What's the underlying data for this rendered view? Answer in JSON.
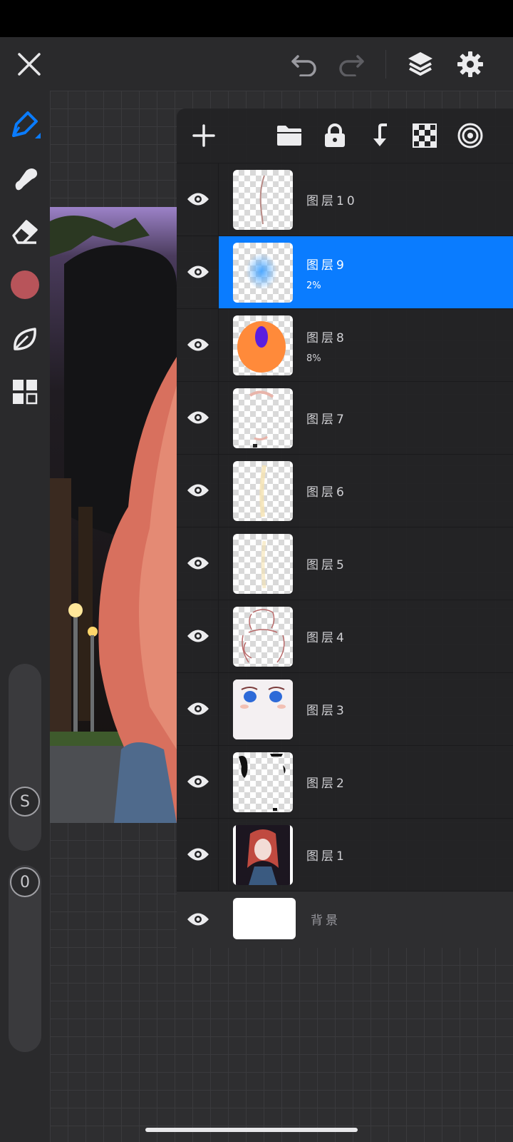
{
  "colors": {
    "accent": "#0a7cff",
    "brush_color": "#b8545a"
  },
  "icons": {
    "top": [
      "close-icon",
      "undo-icon",
      "redo-icon",
      "layers-icon",
      "gear-icon"
    ],
    "tools": [
      "pen-icon",
      "smudge-icon",
      "eraser-icon",
      "color-swatch",
      "leaf-icon",
      "grid-icon"
    ],
    "panel": [
      "add-icon",
      "folder-icon",
      "lock-icon",
      "merge-down-icon",
      "checker-icon",
      "target-icon"
    ]
  },
  "sliders": {
    "size_label": "S",
    "opacity_label": "0"
  },
  "layers": [
    {
      "name": "图层10",
      "opacity": "",
      "selected": false
    },
    {
      "name": "图层9",
      "opacity": "2%",
      "selected": true
    },
    {
      "name": "图层8",
      "opacity": "8%",
      "selected": false
    },
    {
      "name": "图层7",
      "opacity": "",
      "selected": false
    },
    {
      "name": "图层6",
      "opacity": "",
      "selected": false
    },
    {
      "name": "图层5",
      "opacity": "",
      "selected": false
    },
    {
      "name": "图层4",
      "opacity": "",
      "selected": false
    },
    {
      "name": "图层3",
      "opacity": "",
      "selected": false
    },
    {
      "name": "图层2",
      "opacity": "",
      "selected": false
    },
    {
      "name": "图层1",
      "opacity": "",
      "selected": false
    },
    {
      "name": "背景",
      "opacity": "",
      "selected": false
    }
  ]
}
